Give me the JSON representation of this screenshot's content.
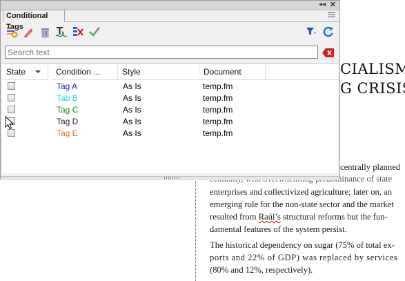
{
  "panel": {
    "tab_title": "Conditional Tags",
    "search_placeholder": "Search text"
  },
  "toolbar_icons": [
    "new-tag-icon",
    "edit-tag-icon",
    "delete-tag-icon",
    "apply-tag-icon",
    "remove-tag-icon",
    "apply-checkmark-icon",
    "filter-icon",
    "refresh-icon"
  ],
  "columns": [
    "State",
    "Condition ...",
    "Style",
    "Document"
  ],
  "rows": [
    {
      "tag": "Tag A",
      "style": "As Is",
      "document": "temp.fm",
      "color": "#1c1cc8"
    },
    {
      "tag": "Tab B",
      "style": "As Is",
      "document": "temp.fm",
      "color": "#18d8d8"
    },
    {
      "tag": "Tag C",
      "style": "As Is",
      "document": "temp.fm",
      "color": "#188a18"
    },
    {
      "tag": "Tag D",
      "style": "As Is",
      "document": "temp.fm",
      "color": "#222222"
    },
    {
      "tag": "Tag E",
      "style": "As Is",
      "document": "temp.fm",
      "color": "#e06a30"
    }
  ],
  "document": {
    "heading_line1": "CIALISM:",
    "heading_line2": "G CRISIS",
    "p1_line1": "centrally planned",
    "p1_line2": "economy, with overwhelming predominance of state",
    "p1_line3": "enterprises and collectivized agriculture; later on, an",
    "p1_line4": "emerging role for the non-state sector and the market",
    "p1_line5_a": "resulted from ",
    "p1_line5_name": "Raúl’s",
    "p1_line5_b": " structural reforms but the fun-",
    "p1_line6": "damental features of the system persist.",
    "p2_line1": "The historical dependency on sugar (75% of total ex-",
    "p2_line2": "ports and 22% of GDP) was replaced by services",
    "p2_line3": "(80% and 12%, respectively)."
  }
}
